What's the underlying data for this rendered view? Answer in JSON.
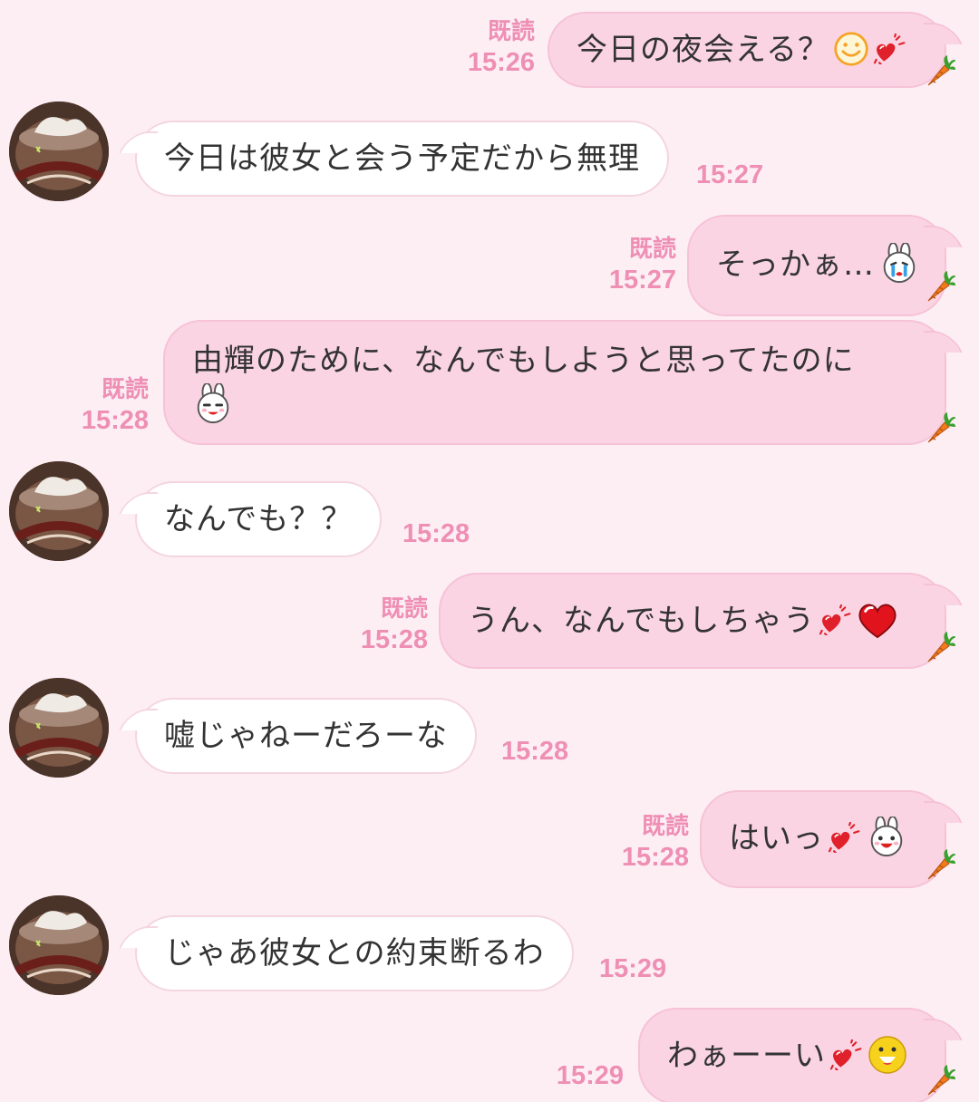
{
  "colors": {
    "background": "#fdeef4",
    "sent_bubble": "#fbd4e3",
    "received_bubble": "#ffffff",
    "meta_text": "#ee8fb3"
  },
  "messages": [
    {
      "side": "sent",
      "text": "今日の夜会える？",
      "icons": [
        "smile-emoji-icon",
        "heart-sticker-icon"
      ],
      "read": "既読",
      "time": "15:26"
    },
    {
      "side": "received",
      "text": "今日は彼女と会う予定だから無理",
      "time": "15:27"
    },
    {
      "side": "sent",
      "text": "そっかぁ…",
      "icons": [
        "crying-bunny-emoji-icon"
      ],
      "read": "既読",
      "time": "15:27"
    },
    {
      "side": "sent",
      "text": "由輝のために、なんでもしようと思ってたのに",
      "icons": [
        "smug-bunny-emoji-icon"
      ],
      "read": "既読",
      "time": "15:28"
    },
    {
      "side": "received",
      "text": "なんでも？？",
      "time": "15:28"
    },
    {
      "side": "sent",
      "text": "うん、なんでもしちゃう",
      "icons": [
        "heart-sticker-icon",
        "red-heart-icon"
      ],
      "read": "既読",
      "time": "15:28"
    },
    {
      "side": "received",
      "text": "嘘じゃねーだろーな",
      "time": "15:28"
    },
    {
      "side": "sent",
      "text": "はいっ",
      "icons": [
        "heart-sticker-icon",
        "happy-bunny-emoji-icon"
      ],
      "read": "既読",
      "time": "15:28"
    },
    {
      "side": "received",
      "text": "じゃあ彼女との約束断るわ",
      "time": "15:29"
    },
    {
      "side": "sent",
      "text": "わぁーーい",
      "icons": [
        "heart-sticker-icon",
        "grinning-face-icon"
      ],
      "time": "15:29"
    }
  ]
}
